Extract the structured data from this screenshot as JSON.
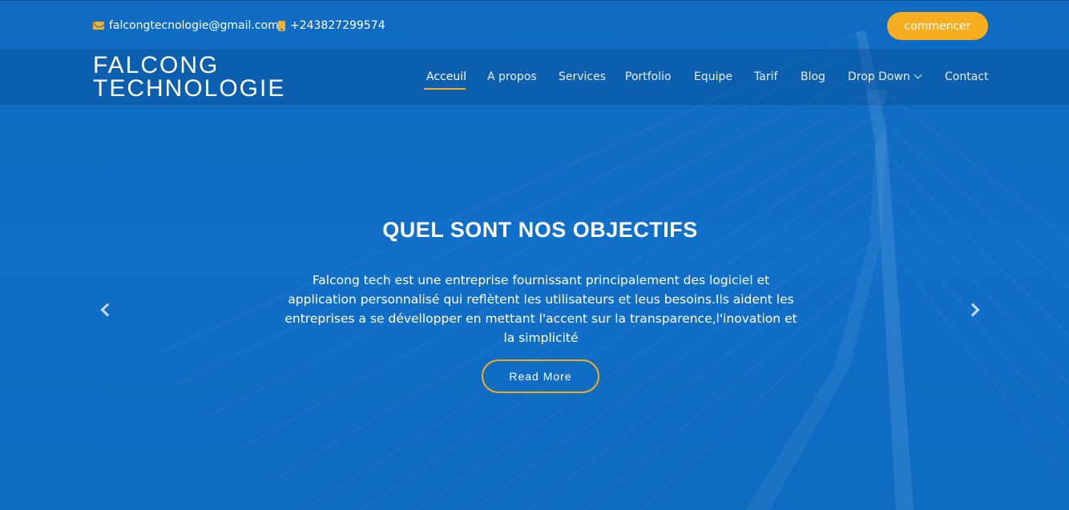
{
  "topbar": {
    "email": "falcongtecnologie@gmail.com",
    "phone": "+243827299574",
    "cta_label": "commencer"
  },
  "brand": {
    "line1": "FALCONG",
    "line2": "TECHNOLOGIE"
  },
  "nav": {
    "items": [
      {
        "label": "Acceuil",
        "active": true
      },
      {
        "label": "A propos"
      },
      {
        "label": "Services"
      },
      {
        "label": "Portfolio"
      },
      {
        "label": "Equipe"
      },
      {
        "label": "Tarif"
      },
      {
        "label": "Blog"
      },
      {
        "label": "Drop Down"
      },
      {
        "label": "Contact"
      }
    ]
  },
  "hero": {
    "title": "QUEL SONT NOS OBJECTIFS",
    "text": "Falcong tech est une entreprise fournissant principalement des logiciel et application personnalisé qui reflètent les utilisateurs et leus besoins.Ils aident les entreprises a se dévellopper en mettant l'accent sur la transparence,l'inovation et la simplicité",
    "button_label": "Read More"
  },
  "colors": {
    "primary": "#0f6cc2",
    "accent": "#f6ae1e",
    "nav_overlay": "#084e96"
  },
  "icons": {
    "email": "mail-icon",
    "phone": "phone-icon",
    "dropdown": "chevron-down-icon",
    "prev": "chevron-left-icon",
    "next": "chevron-right-icon"
  }
}
